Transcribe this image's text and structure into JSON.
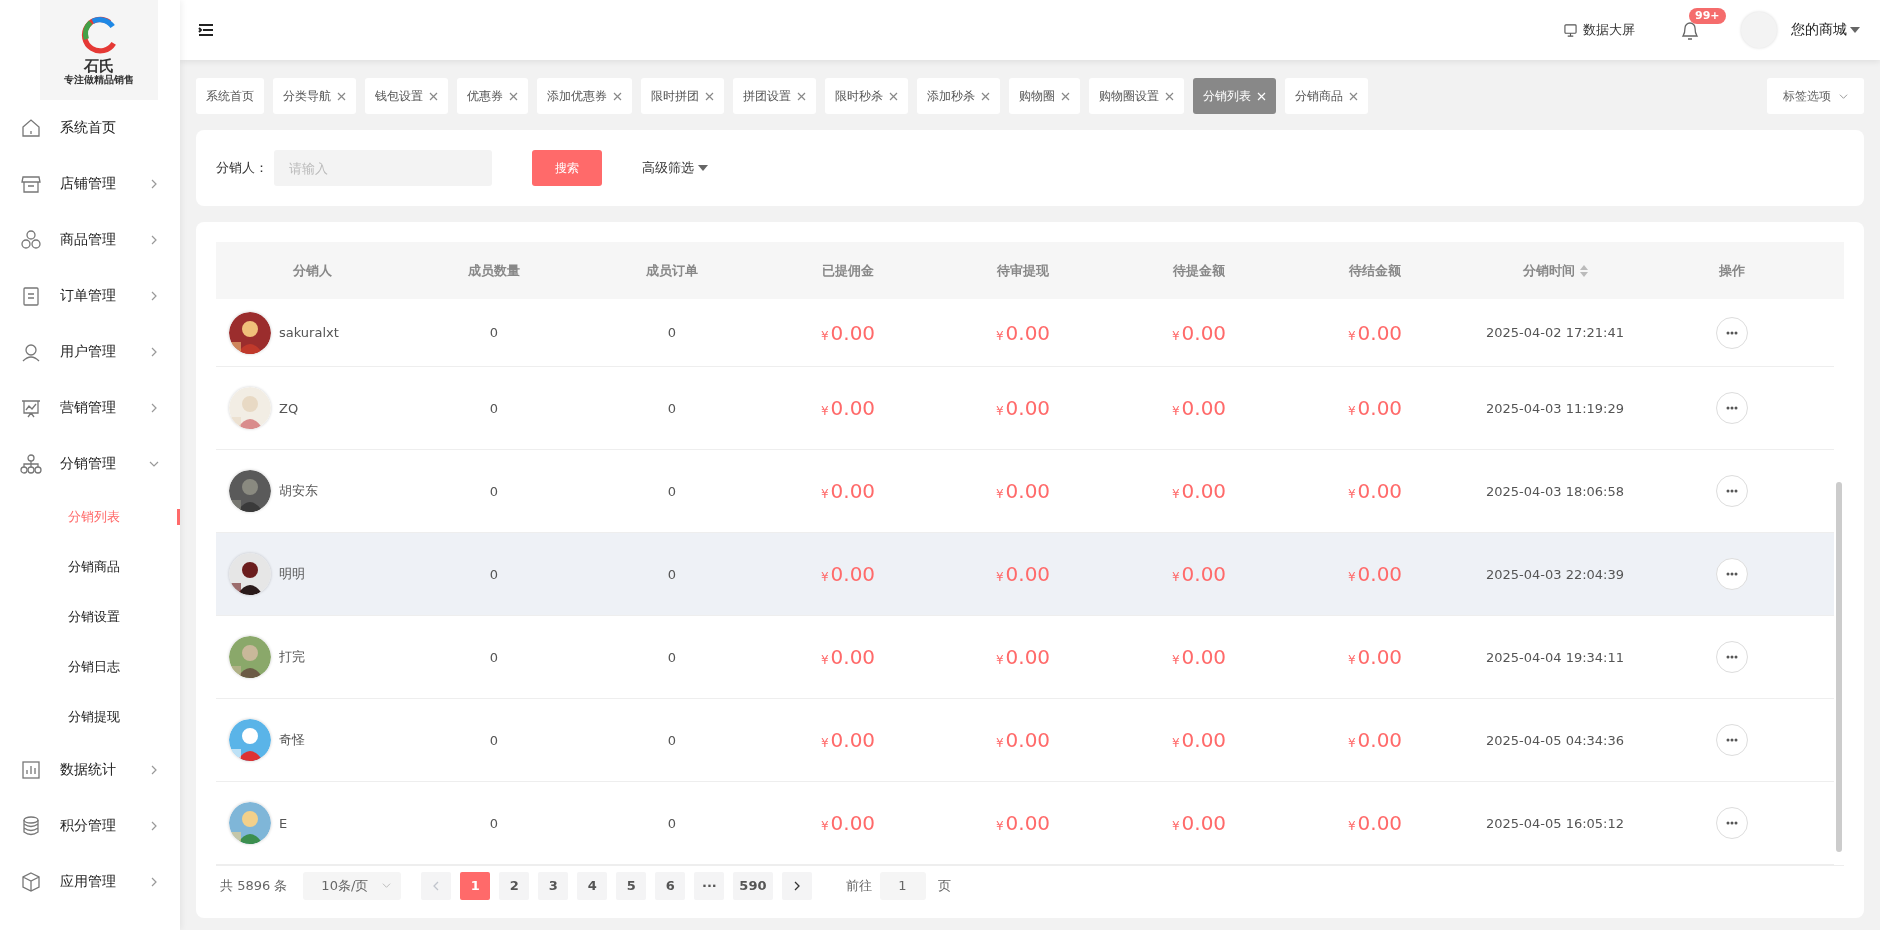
{
  "sidebar": {
    "logo": {
      "title": "石氏",
      "tagline": "专注做精品销售"
    },
    "items": [
      {
        "label": "系统首页",
        "selected": false
      },
      {
        "label": "店铺管理",
        "selected": false,
        "expanded": false
      },
      {
        "label": "商品管理",
        "selected": false,
        "expanded": false
      },
      {
        "label": "订单管理",
        "selected": false,
        "expanded": false
      },
      {
        "label": "用户管理",
        "selected": false,
        "expanded": false
      },
      {
        "label": "营销管理",
        "selected": false,
        "expanded": false
      },
      {
        "label": "分销管理",
        "selected": false,
        "expanded": true,
        "children": [
          {
            "label": "分销列表",
            "selected": true
          },
          {
            "label": "分销商品",
            "selected": false
          },
          {
            "label": "分销设置",
            "selected": false
          },
          {
            "label": "分销日志",
            "selected": false
          },
          {
            "label": "分销提现",
            "selected": false
          }
        ]
      },
      {
        "label": "数据统计",
        "selected": false,
        "expanded": false
      },
      {
        "label": "积分管理",
        "selected": false,
        "expanded": false
      },
      {
        "label": "应用管理",
        "selected": false,
        "expanded": false
      }
    ]
  },
  "header": {
    "screen_link": "数据大屏",
    "notification_badge": "99+",
    "store_menu": "您的商城"
  },
  "tabs": [
    {
      "label": "系统首页",
      "selected": false,
      "closable": false
    },
    {
      "label": "分类导航",
      "selected": false,
      "closable": true
    },
    {
      "label": "钱包设置",
      "selected": false,
      "closable": true
    },
    {
      "label": "优惠券",
      "selected": false,
      "closable": true
    },
    {
      "label": "添加优惠券",
      "selected": false,
      "closable": true
    },
    {
      "label": "限时拼团",
      "selected": false,
      "closable": true
    },
    {
      "label": "拼团设置",
      "selected": false,
      "closable": true
    },
    {
      "label": "限时秒杀",
      "selected": false,
      "closable": true
    },
    {
      "label": "添加秒杀",
      "selected": false,
      "closable": true
    },
    {
      "label": "购物圈",
      "selected": false,
      "closable": true
    },
    {
      "label": "购物圈设置",
      "selected": false,
      "closable": true
    },
    {
      "label": "分销列表",
      "selected": true,
      "closable": true
    },
    {
      "label": "分销商品",
      "selected": false,
      "closable": true
    }
  ],
  "tab_options": "标签选项",
  "filter": {
    "label": "分销人：",
    "placeholder": "请输入",
    "search_button": "搜索",
    "advanced": "高级筛选"
  },
  "table": {
    "columns": [
      {
        "label": "分销人",
        "sortable": false
      },
      {
        "label": "成员数量",
        "sortable": false
      },
      {
        "label": "成员订单",
        "sortable": false
      },
      {
        "label": "已提佣金",
        "sortable": false
      },
      {
        "label": "待审提现",
        "sortable": false
      },
      {
        "label": "待提金额",
        "sortable": false
      },
      {
        "label": "待结金额",
        "sortable": false
      },
      {
        "label": "分销时间",
        "sortable": true
      },
      {
        "label": "操作",
        "sortable": false
      }
    ],
    "rows": [
      {
        "name": "sakuralxt",
        "members": "0",
        "orders": "0",
        "amounts": [
          {
            "currency": "¥",
            "amount": "0.00"
          },
          {
            "currency": "¥",
            "amount": "0.00"
          },
          {
            "currency": "¥",
            "amount": "0.00"
          },
          {
            "currency": "¥",
            "amount": "0.00"
          }
        ],
        "time": "2025-04-02 17:21:41",
        "hovered": false
      },
      {
        "name": "ZQ",
        "members": "0",
        "orders": "0",
        "amounts": [
          {
            "currency": "¥",
            "amount": "0.00"
          },
          {
            "currency": "¥",
            "amount": "0.00"
          },
          {
            "currency": "¥",
            "amount": "0.00"
          },
          {
            "currency": "¥",
            "amount": "0.00"
          }
        ],
        "time": "2025-04-03 11:19:29",
        "hovered": false
      },
      {
        "name": "胡安东",
        "members": "0",
        "orders": "0",
        "amounts": [
          {
            "currency": "¥",
            "amount": "0.00"
          },
          {
            "currency": "¥",
            "amount": "0.00"
          },
          {
            "currency": "¥",
            "amount": "0.00"
          },
          {
            "currency": "¥",
            "amount": "0.00"
          }
        ],
        "time": "2025-04-03 18:06:58",
        "hovered": false
      },
      {
        "name": "明明",
        "members": "0",
        "orders": "0",
        "amounts": [
          {
            "currency": "¥",
            "amount": "0.00"
          },
          {
            "currency": "¥",
            "amount": "0.00"
          },
          {
            "currency": "¥",
            "amount": "0.00"
          },
          {
            "currency": "¥",
            "amount": "0.00"
          }
        ],
        "time": "2025-04-03 22:04:39",
        "hovered": true
      },
      {
        "name": "打完",
        "members": "0",
        "orders": "0",
        "amounts": [
          {
            "currency": "¥",
            "amount": "0.00"
          },
          {
            "currency": "¥",
            "amount": "0.00"
          },
          {
            "currency": "¥",
            "amount": "0.00"
          },
          {
            "currency": "¥",
            "amount": "0.00"
          }
        ],
        "time": "2025-04-04 19:34:11",
        "hovered": false
      },
      {
        "name": "奇怪",
        "members": "0",
        "orders": "0",
        "amounts": [
          {
            "currency": "¥",
            "amount": "0.00"
          },
          {
            "currency": "¥",
            "amount": "0.00"
          },
          {
            "currency": "¥",
            "amount": "0.00"
          },
          {
            "currency": "¥",
            "amount": "0.00"
          }
        ],
        "time": "2025-04-05 04:34:36",
        "hovered": false
      },
      {
        "name": "E",
        "members": "0",
        "orders": "0",
        "amounts": [
          {
            "currency": "¥",
            "amount": "0.00"
          },
          {
            "currency": "¥",
            "amount": "0.00"
          },
          {
            "currency": "¥",
            "amount": "0.00"
          },
          {
            "currency": "¥",
            "amount": "0.00"
          }
        ],
        "time": "2025-04-05 16:05:12",
        "hovered": false
      }
    ]
  },
  "pagination": {
    "total": "共 5896 条",
    "page_size": "10条/页",
    "prev_disabled": true,
    "pages": [
      {
        "label": "1",
        "selected": true
      },
      {
        "label": "2",
        "selected": false
      },
      {
        "label": "3",
        "selected": false
      },
      {
        "label": "4",
        "selected": false
      },
      {
        "label": "5",
        "selected": false
      },
      {
        "label": "6",
        "selected": false
      },
      {
        "label": "···",
        "selected": false
      },
      {
        "label": "590",
        "selected": false
      }
    ],
    "goto_label": "前往",
    "goto_value": "1",
    "goto_suffix": "页"
  }
}
